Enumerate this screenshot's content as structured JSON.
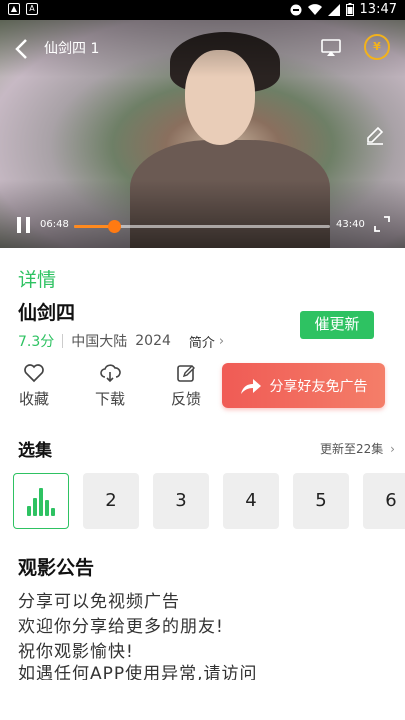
{
  "status_bar": {
    "time": "13:47",
    "left_icons": [
      "image-icon",
      "text-icon"
    ]
  },
  "player": {
    "title": "仙剑四 1",
    "current_time": "06:48",
    "duration": "43:40",
    "progress": 0.156
  },
  "detail": {
    "tab_label": "详情",
    "title": "仙剑四",
    "score": "7.3分",
    "region": "中国大陆",
    "year": "2024",
    "intro_label": "简介",
    "urge_button": "催更新"
  },
  "actions": {
    "favorite": "收藏",
    "download": "下载",
    "feedback": "反馈",
    "share": "分享好友免广告"
  },
  "episodes": {
    "title": "选集",
    "update_info": "更新至22集",
    "items": [
      "",
      "2",
      "3",
      "4",
      "5",
      "6"
    ]
  },
  "notice": {
    "title": "观影公告",
    "lines": [
      "分享可以免视频广告",
      "欢迎你分享给更多的朋友!",
      "祝你观影愉快!",
      "如遇任何APP使用异常,请访问"
    ]
  },
  "colors": {
    "accent": "#2ec262",
    "share": "#f05b55",
    "progress": "#ff7a12"
  }
}
